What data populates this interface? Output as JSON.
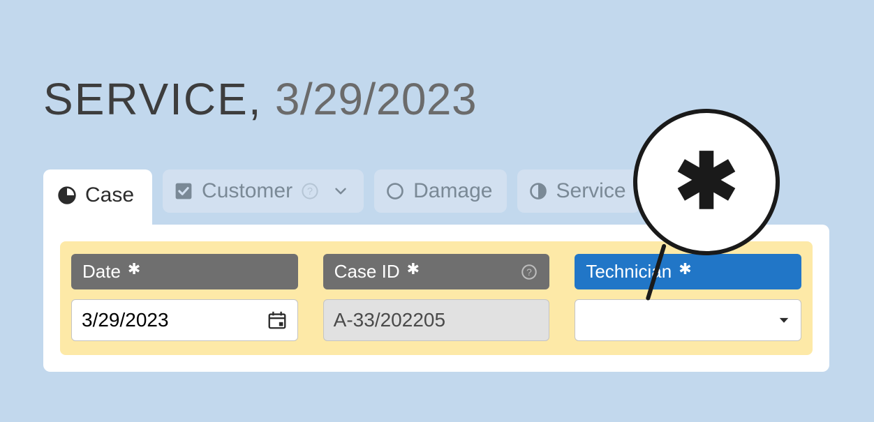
{
  "header": {
    "prefix": "SERVICE,",
    "date": "3/29/2023"
  },
  "tabs": [
    {
      "id": "case",
      "label": "Case",
      "icon": "pie-75"
    },
    {
      "id": "customer",
      "label": "Customer",
      "icon": "checkbox-on"
    },
    {
      "id": "damage",
      "label": "Damage",
      "icon": "circle-empty"
    },
    {
      "id": "service",
      "label": "Service",
      "icon": "circle-half"
    }
  ],
  "active_tab": "case",
  "fields": {
    "date": {
      "label": "Date",
      "required": true,
      "value": "3/29/2023"
    },
    "case_id": {
      "label": "Case ID",
      "required": true,
      "value": "A-33/202205"
    },
    "technician": {
      "label": "Technician",
      "required": true,
      "value": ""
    }
  },
  "callout": {
    "glyph": "✱"
  }
}
